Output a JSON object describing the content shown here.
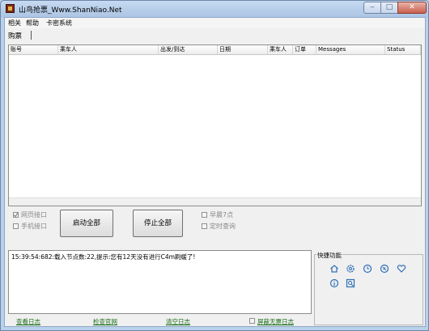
{
  "window": {
    "title": "山鸟抢票_Www.ShanNiao.Net"
  },
  "titlebar_buttons": {
    "minimize": "‒",
    "maximize": "□",
    "close": "✕"
  },
  "menu": [
    "相关",
    "帮助",
    "卡密系统"
  ],
  "tabs": [
    {
      "label": "购票",
      "active": true
    }
  ],
  "grid": {
    "columns": [
      "账号",
      "乘车人",
      "出发/到达",
      "日期",
      "乘车人",
      "订单",
      "Messages",
      "Status"
    ]
  },
  "options": {
    "web_api": {
      "label": "网页接口",
      "checked": true,
      "enabled": false
    },
    "mobile_api": {
      "label": "手机接口",
      "checked": false,
      "enabled": false
    },
    "early_7": {
      "label": "早晨7点",
      "checked": false,
      "enabled": false
    },
    "scheduled_query": {
      "label": "定时查询",
      "checked": false,
      "enabled": false
    }
  },
  "buttons": {
    "start_all": "启动全部",
    "stop_all": "停止全部"
  },
  "log": {
    "line": "15:39:54:682:载入节点数:22,提示:您有12天没有进行C4m刷缓了!"
  },
  "quick": {
    "title": "快捷功能",
    "icons": [
      "home-icon",
      "settings-icon",
      "clock-icon",
      "link-icon",
      "heart-icon",
      "info-icon",
      "image-icon"
    ]
  },
  "footer": {
    "view_log": "查看日志",
    "check_site": "检查官网",
    "clear_log": "清空日志",
    "block_useless": {
      "label": "屏蔽无票日志",
      "checked": false
    }
  }
}
